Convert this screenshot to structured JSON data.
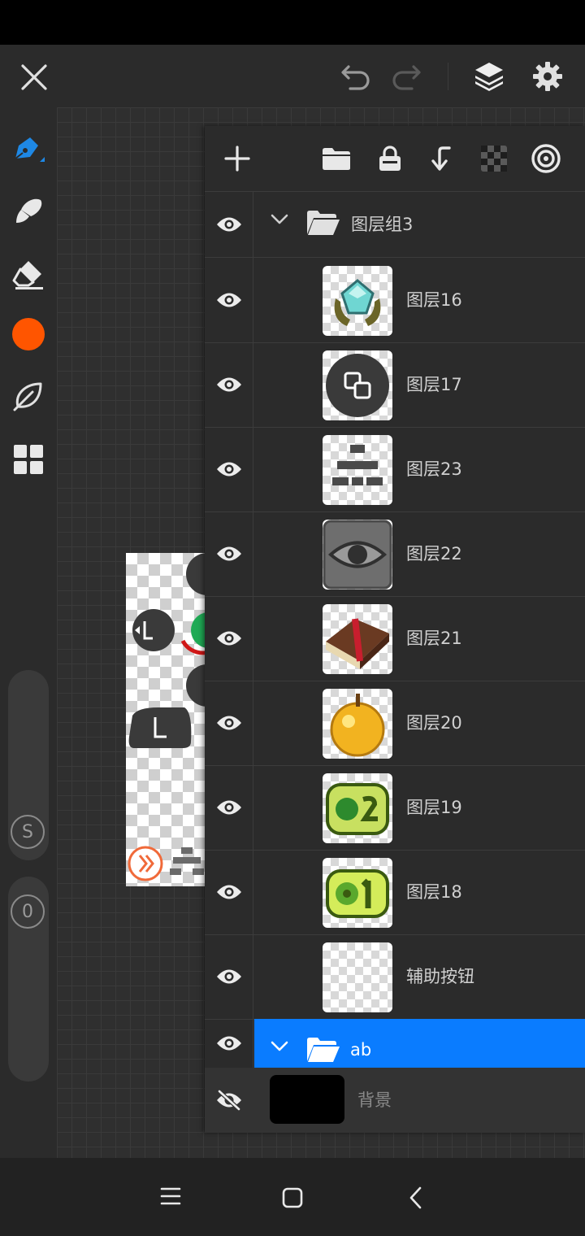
{
  "topbar": {
    "close_icon": "close-icon",
    "undo_icon": "undo-icon",
    "redo_icon": "redo-icon",
    "layers_icon": "layers-icon",
    "settings_icon": "gear-icon"
  },
  "tools": {
    "items": [
      "pen-icon",
      "brush-icon",
      "eraser-icon",
      "color-swatch",
      "leaf-icon",
      "grid-icon"
    ],
    "current_color": "#ff5500",
    "accent_color": "#1e88e5",
    "size_badge": "S",
    "opacity_badge": "0"
  },
  "layers_panel": {
    "toolbar_icons": [
      "plus-icon",
      "folder-icon",
      "lock-icon",
      "merge-down-icon",
      "checker-icon",
      "target-icon"
    ],
    "group": {
      "name": "图层组3",
      "expanded": true
    },
    "layers": [
      {
        "name": "图层16",
        "visible": true,
        "thumb": "diamond-emblem"
      },
      {
        "name": "图层17",
        "visible": true,
        "thumb": "copy-button"
      },
      {
        "name": "图层23",
        "visible": true,
        "thumb": "pixel-tree"
      },
      {
        "name": "图层22",
        "visible": true,
        "thumb": "eye-button"
      },
      {
        "name": "图层21",
        "visible": true,
        "thumb": "book"
      },
      {
        "name": "图层20",
        "visible": true,
        "thumb": "golden-apple"
      },
      {
        "name": "图层19",
        "visible": true,
        "thumb": "green-badge-2"
      },
      {
        "name": "图层18",
        "visible": true,
        "thumb": "green-badge-1"
      },
      {
        "name": "辅助按钮",
        "visible": true,
        "thumb": "empty"
      }
    ],
    "selected_group": {
      "name": "ab",
      "expanded": true
    },
    "background": {
      "name": "背景",
      "visible": false,
      "color": "#000000"
    },
    "selected_color": "#0a7cff"
  },
  "artwork": {
    "labels": [
      "L",
      "L",
      "L",
      "L"
    ]
  },
  "navbar": {
    "menu_icon": "menu-icon",
    "home_icon": "home-icon",
    "back_icon": "back-icon"
  }
}
